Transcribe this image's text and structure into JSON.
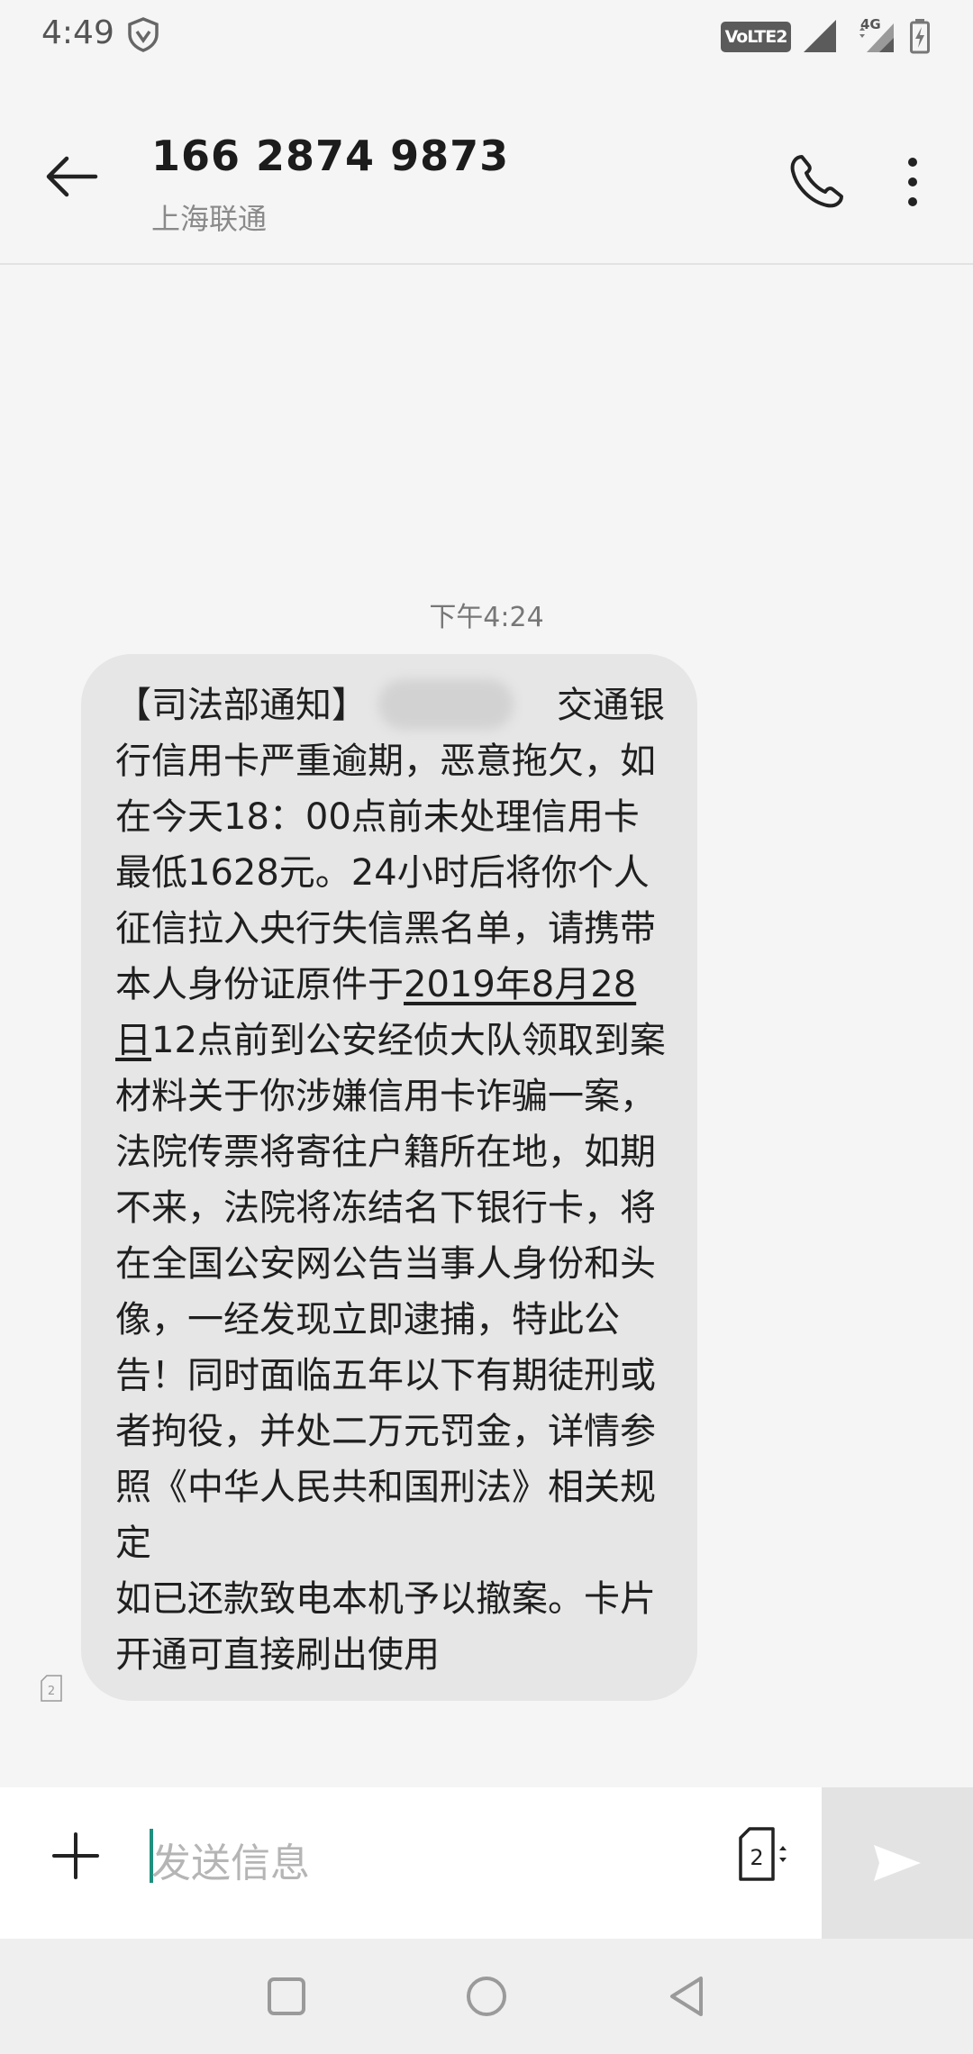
{
  "status_bar": {
    "time": "4:49",
    "volte_label": "VoLTE2",
    "network_type": "4G",
    "icons": [
      "vpn-shield-icon",
      "signal-icon",
      "signal-4g-icon",
      "battery-charging-icon"
    ]
  },
  "header": {
    "title": "166 2874 9873",
    "subtitle": "上海联通",
    "icons": [
      "back-arrow-icon",
      "phone-icon",
      "more-vertical-icon"
    ]
  },
  "conversation": {
    "timestamp": "下午4:24",
    "message": {
      "part1": "【司法部通知】",
      "part2": "交通银行信用卡严重逾期，恶意拖欠，如在今天18：00点前未处理信用卡最低1628元。24小时后将你个人征信拉入央行失信黑名单，请携带本人身份证原件于",
      "underlined": "2019年8月28日",
      "part3": "12点前到公安经侦大队领取到案材料关于你涉嫌信用卡诈骗一案，法院传票将寄往户籍所在地，如期不来，法院将冻结名下银行卡，将在全国公安网公告当事人身份和头像，一经发现立即逮捕，特此公告！同时面临五年以下有期徒刑或者拘役，并处二万元罚金，详情参照《中华人民共和国刑法》相关规定\n如已还款致电本机予以撤案。卡片开通可直接刷出使用"
    },
    "sim_indicator": "2"
  },
  "compose": {
    "placeholder": "发送信息",
    "value": "",
    "sim_slot": "2"
  },
  "colors": {
    "background": "#f5f5f5",
    "bubble": "#e6e6e6",
    "cursor_accent": "#1f8f7e",
    "send_button_bg": "#e3e3e3"
  }
}
